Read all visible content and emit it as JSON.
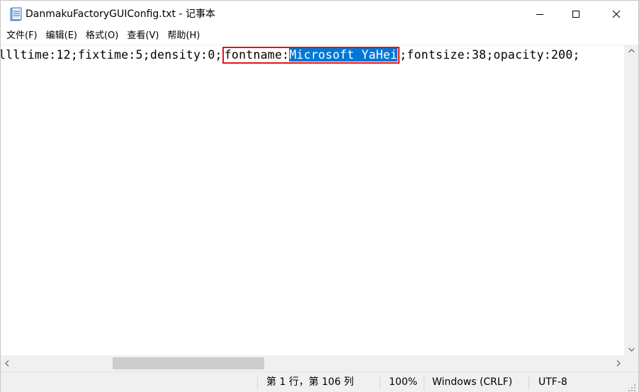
{
  "window": {
    "title": "DanmakuFactoryGUIConfig.txt - 记事本"
  },
  "menu": {
    "items": [
      "文件(F)",
      "编辑(E)",
      "格式(O)",
      "查看(V)",
      "帮助(H)"
    ]
  },
  "editor": {
    "before_box": "llltime:12;fixtime:5;density:0;",
    "boxed_prefix": "fontname:",
    "selected_text": "Microsoft YaHei",
    "after_box": ";fontsize:38;opacity:200;"
  },
  "status": {
    "position": "第 1 行，第 106 列",
    "zoom": "100%",
    "line_ending": "Windows (CRLF)",
    "encoding": "UTF-8"
  },
  "colors": {
    "selection": "#0078d7",
    "highlight_box": "#e0141e"
  },
  "icons": {
    "app": "notepad-icon",
    "minimize": "minimize-icon",
    "maximize": "maximize-icon",
    "close": "close-icon"
  }
}
